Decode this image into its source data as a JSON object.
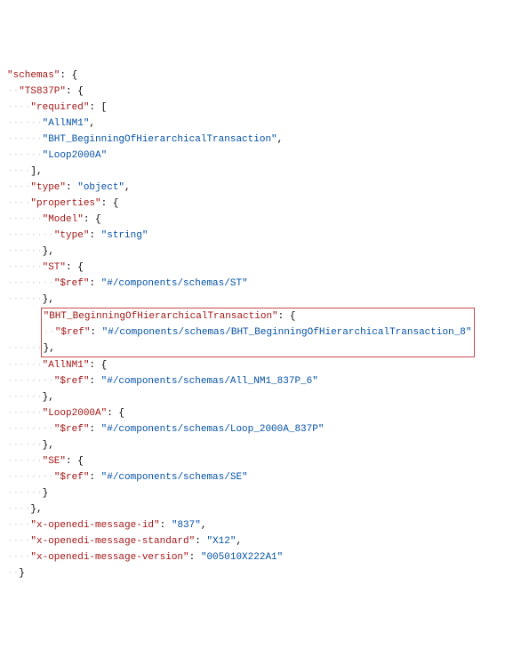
{
  "lines": [
    {
      "guide": "",
      "segs": [
        {
          "t": "\"schemas\"",
          "c": "key"
        },
        {
          "t": ": {",
          "c": "pun"
        }
      ]
    },
    {
      "guide": "··",
      "segs": [
        {
          "t": "\"TS837P\"",
          "c": "key"
        },
        {
          "t": ": {",
          "c": "pun"
        }
      ]
    },
    {
      "guide": "····",
      "segs": [
        {
          "t": "\"required\"",
          "c": "key"
        },
        {
          "t": ": [",
          "c": "pun"
        }
      ]
    },
    {
      "guide": "······",
      "segs": [
        {
          "t": "\"AllNM1\"",
          "c": "str"
        },
        {
          "t": ",",
          "c": "pun"
        }
      ]
    },
    {
      "guide": "······",
      "segs": [
        {
          "t": "\"BHT_BeginningOfHierarchicalTransaction\"",
          "c": "str"
        },
        {
          "t": ",",
          "c": "pun"
        }
      ]
    },
    {
      "guide": "······",
      "segs": [
        {
          "t": "\"Loop2000A\"",
          "c": "str"
        }
      ]
    },
    {
      "guide": "····",
      "segs": [
        {
          "t": "],",
          "c": "pun"
        }
      ]
    },
    {
      "guide": "····",
      "segs": [
        {
          "t": "\"type\"",
          "c": "key"
        },
        {
          "t": ": ",
          "c": "pun"
        },
        {
          "t": "\"object\"",
          "c": "str"
        },
        {
          "t": ",",
          "c": "pun"
        }
      ]
    },
    {
      "guide": "····",
      "segs": [
        {
          "t": "\"properties\"",
          "c": "key"
        },
        {
          "t": ": {",
          "c": "pun"
        }
      ]
    },
    {
      "guide": "······",
      "segs": [
        {
          "t": "\"Model\"",
          "c": "key"
        },
        {
          "t": ": {",
          "c": "pun"
        }
      ]
    },
    {
      "guide": "········",
      "segs": [
        {
          "t": "\"type\"",
          "c": "key"
        },
        {
          "t": ": ",
          "c": "pun"
        },
        {
          "t": "\"string\"",
          "c": "str"
        }
      ]
    },
    {
      "guide": "······",
      "segs": [
        {
          "t": "},",
          "c": "pun"
        }
      ]
    },
    {
      "guide": "······",
      "segs": [
        {
          "t": "\"ST\"",
          "c": "key"
        },
        {
          "t": ": {",
          "c": "pun"
        }
      ]
    },
    {
      "guide": "········",
      "segs": [
        {
          "t": "\"$ref\"",
          "c": "key"
        },
        {
          "t": ": ",
          "c": "pun"
        },
        {
          "t": "\"#/components/schemas/ST\"",
          "c": "str"
        }
      ]
    },
    {
      "guide": "······",
      "segs": [
        {
          "t": "},",
          "c": "pun"
        }
      ]
    },
    {
      "guide": "······",
      "box": true,
      "segs": [
        {
          "t": "\"BHT_BeginningOfHierarchicalTransaction\"",
          "c": "key"
        },
        {
          "t": ": {",
          "c": "pun"
        }
      ]
    },
    {
      "guide": "······",
      "box": true,
      "segs": [
        {
          "t": "··",
          "c": "guide"
        },
        {
          "t": "\"$ref\"",
          "c": "key"
        },
        {
          "t": ": ",
          "c": "pun"
        },
        {
          "t": "\"#/components/schemas/BHT_BeginningOfHierarchicalTransaction_8\"",
          "c": "str"
        }
      ]
    },
    {
      "guide": "······",
      "box": true,
      "segs": [
        {
          "t": "},",
          "c": "pun"
        }
      ]
    },
    {
      "guide": "······",
      "segs": [
        {
          "t": "\"AllNM1\"",
          "c": "key"
        },
        {
          "t": ": {",
          "c": "pun"
        }
      ]
    },
    {
      "guide": "········",
      "segs": [
        {
          "t": "\"$ref\"",
          "c": "key"
        },
        {
          "t": ": ",
          "c": "pun"
        },
        {
          "t": "\"#/components/schemas/All_NM1_837P_6\"",
          "c": "str"
        }
      ]
    },
    {
      "guide": "······",
      "segs": [
        {
          "t": "},",
          "c": "pun"
        }
      ]
    },
    {
      "guide": "······",
      "segs": [
        {
          "t": "\"Loop2000A\"",
          "c": "key"
        },
        {
          "t": ": {",
          "c": "pun"
        }
      ]
    },
    {
      "guide": "········",
      "segs": [
        {
          "t": "\"$ref\"",
          "c": "key"
        },
        {
          "t": ": ",
          "c": "pun"
        },
        {
          "t": "\"#/components/schemas/Loop_2000A_837P\"",
          "c": "str"
        }
      ]
    },
    {
      "guide": "······",
      "segs": [
        {
          "t": "},",
          "c": "pun"
        }
      ]
    },
    {
      "guide": "······",
      "segs": [
        {
          "t": "\"SE\"",
          "c": "key"
        },
        {
          "t": ": {",
          "c": "pun"
        }
      ]
    },
    {
      "guide": "········",
      "segs": [
        {
          "t": "\"$ref\"",
          "c": "key"
        },
        {
          "t": ": ",
          "c": "pun"
        },
        {
          "t": "\"#/components/schemas/SE\"",
          "c": "str"
        }
      ]
    },
    {
      "guide": "······",
      "segs": [
        {
          "t": "}",
          "c": "pun"
        }
      ]
    },
    {
      "guide": "····",
      "segs": [
        {
          "t": "},",
          "c": "pun"
        }
      ]
    },
    {
      "guide": "····",
      "segs": [
        {
          "t": "\"x-openedi-message-id\"",
          "c": "key"
        },
        {
          "t": ": ",
          "c": "pun"
        },
        {
          "t": "\"837\"",
          "c": "str"
        },
        {
          "t": ",",
          "c": "pun"
        }
      ]
    },
    {
      "guide": "····",
      "segs": [
        {
          "t": "\"x-openedi-message-standard\"",
          "c": "key"
        },
        {
          "t": ": ",
          "c": "pun"
        },
        {
          "t": "\"X12\"",
          "c": "str"
        },
        {
          "t": ",",
          "c": "pun"
        }
      ]
    },
    {
      "guide": "····",
      "segs": [
        {
          "t": "\"x-openedi-message-version\"",
          "c": "key"
        },
        {
          "t": ": ",
          "c": "pun"
        },
        {
          "t": "\"005010X222A1\"",
          "c": "str"
        }
      ]
    },
    {
      "guide": "··",
      "segs": [
        {
          "t": "}",
          "c": "pun"
        }
      ]
    }
  ]
}
